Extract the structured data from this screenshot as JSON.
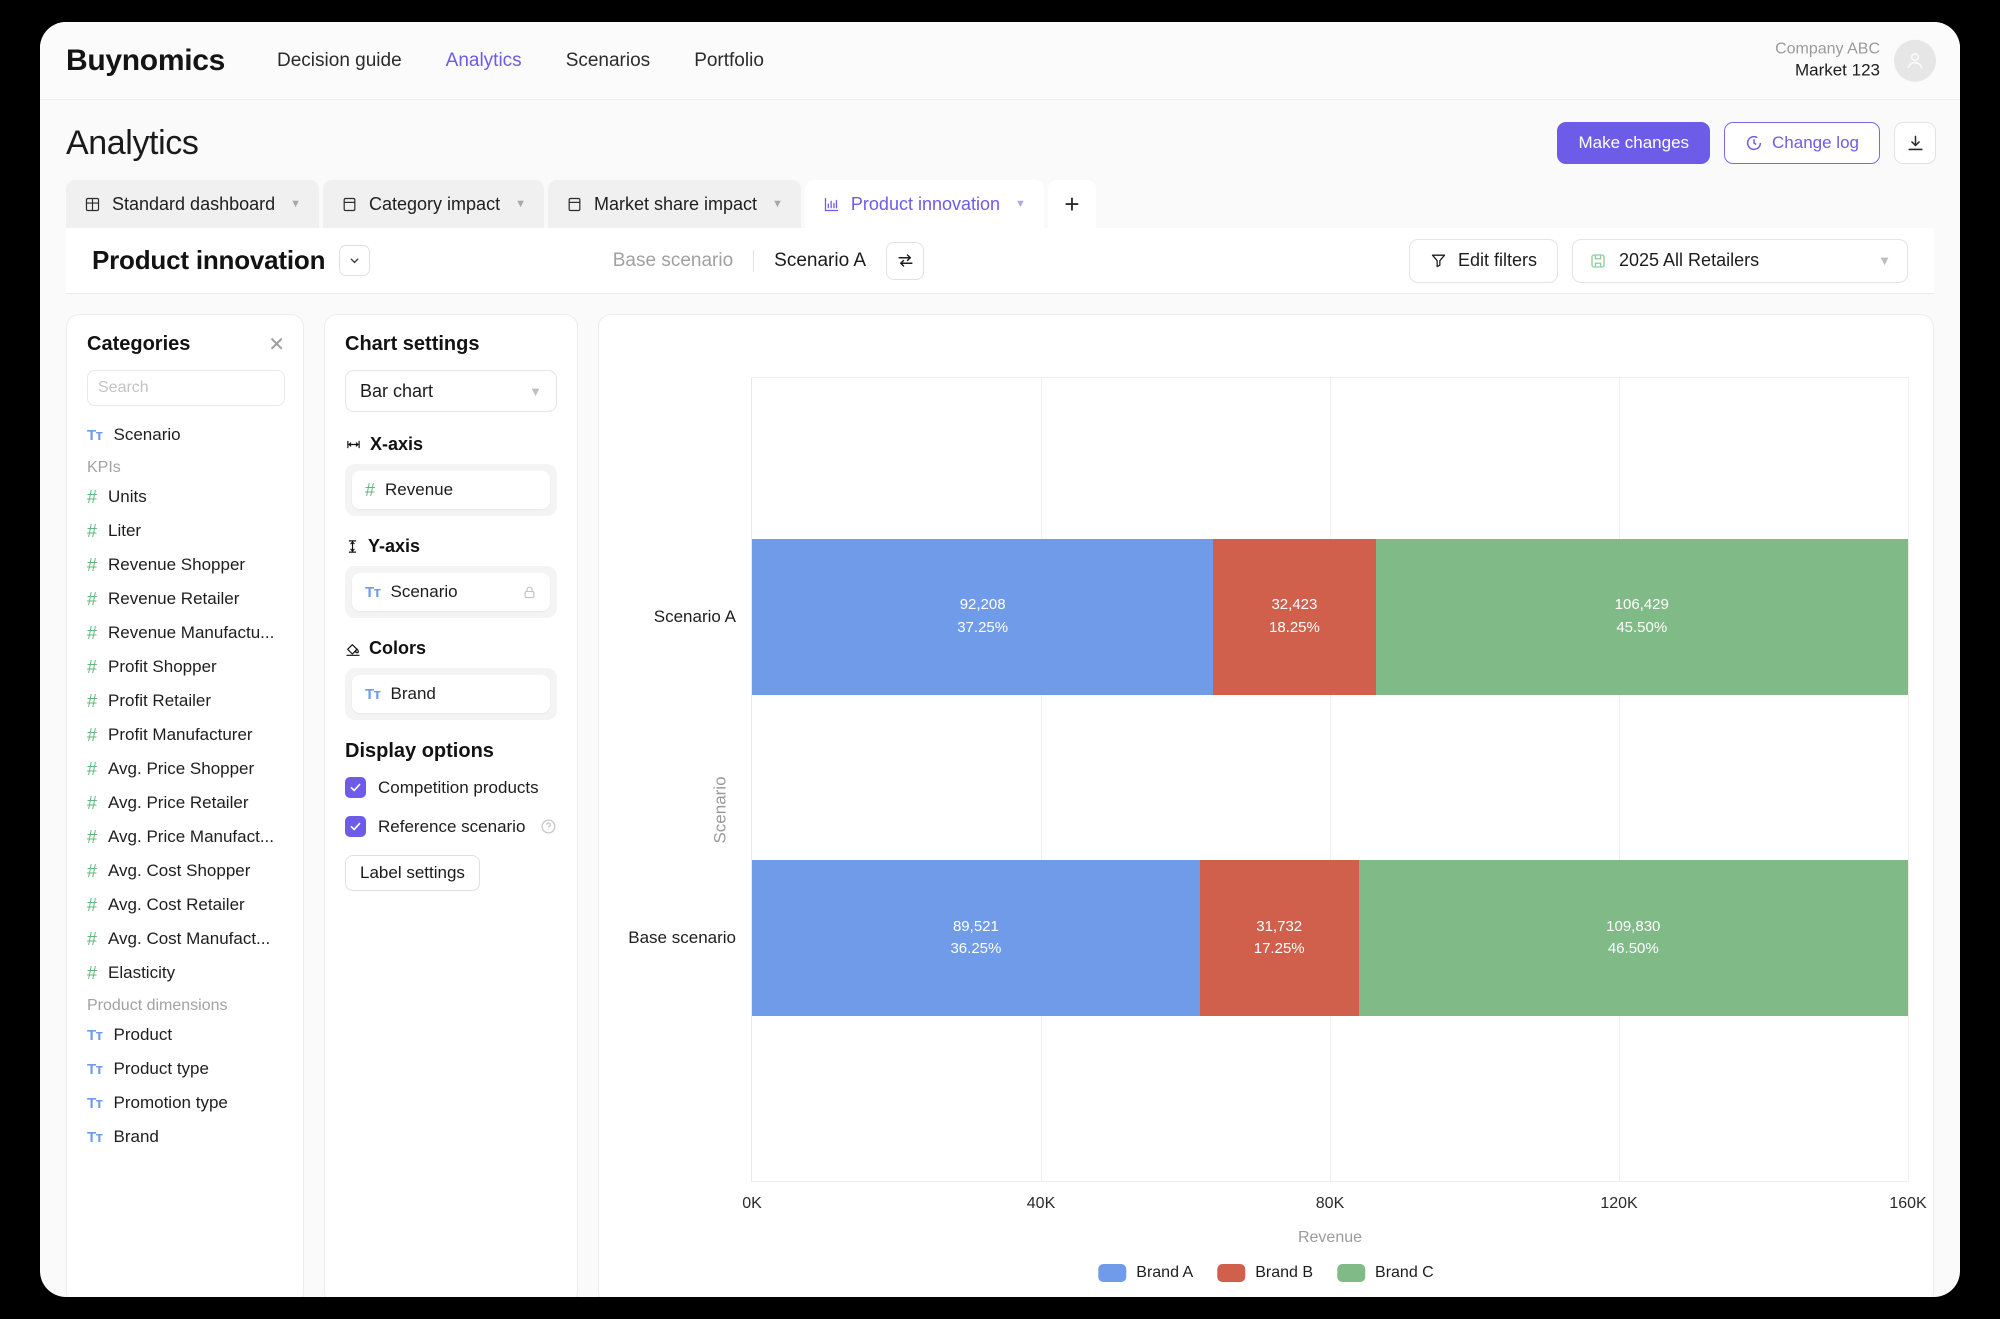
{
  "topnav": {
    "brand": "Buynomics",
    "links": [
      {
        "label": "Decision guide",
        "active": false
      },
      {
        "label": "Analytics",
        "active": true
      },
      {
        "label": "Scenarios",
        "active": false
      },
      {
        "label": "Portfolio",
        "active": false
      }
    ],
    "account": {
      "company": "Company ABC",
      "market": "Market 123"
    }
  },
  "header": {
    "title": "Analytics",
    "make_changes": "Make changes",
    "change_log": "Change log"
  },
  "tabs": [
    {
      "label": "Standard dashboard",
      "icon": "dashboard-icon",
      "active": false
    },
    {
      "label": "Category impact",
      "icon": "panel-icon",
      "active": false
    },
    {
      "label": "Market share impact",
      "icon": "panel-icon",
      "active": false
    },
    {
      "label": "Product innovation",
      "icon": "bar-chart-icon",
      "active": true
    }
  ],
  "tab_add_label": "+",
  "toolbar": {
    "title": "Product innovation",
    "base_scenario": "Base scenario",
    "scenario_a": "Scenario A",
    "edit_filters": "Edit filters",
    "retailer_selection": "2025 All Retailers"
  },
  "categories": {
    "title": "Categories",
    "search_placeholder": "Search",
    "search_value": "",
    "items": [
      {
        "label": "Scenario",
        "icon": "text-type-icon",
        "type": "text"
      },
      {
        "label": "KPIs",
        "type": "group"
      },
      {
        "label": "Units",
        "icon": "number-type-icon",
        "type": "number"
      },
      {
        "label": "Liter",
        "icon": "number-type-icon",
        "type": "number"
      },
      {
        "label": "Revenue Shopper",
        "icon": "number-type-icon",
        "type": "number"
      },
      {
        "label": "Revenue Retailer",
        "icon": "number-type-icon",
        "type": "number"
      },
      {
        "label": "Revenue Manufactu...",
        "icon": "number-type-icon",
        "type": "number"
      },
      {
        "label": "Profit Shopper",
        "icon": "number-type-icon",
        "type": "number"
      },
      {
        "label": "Profit Retailer",
        "icon": "number-type-icon",
        "type": "number"
      },
      {
        "label": "Profit Manufacturer",
        "icon": "number-type-icon",
        "type": "number"
      },
      {
        "label": "Avg. Price Shopper",
        "icon": "number-type-icon",
        "type": "number"
      },
      {
        "label": "Avg. Price Retailer",
        "icon": "number-type-icon",
        "type": "number"
      },
      {
        "label": "Avg. Price Manufact...",
        "icon": "number-type-icon",
        "type": "number"
      },
      {
        "label": "Avg. Cost Shopper",
        "icon": "number-type-icon",
        "type": "number"
      },
      {
        "label": "Avg. Cost Retailer",
        "icon": "number-type-icon",
        "type": "number"
      },
      {
        "label": "Avg. Cost Manufact...",
        "icon": "number-type-icon",
        "type": "number"
      },
      {
        "label": "Elasticity",
        "icon": "number-type-icon",
        "type": "number"
      },
      {
        "label": "Product dimensions",
        "type": "group"
      },
      {
        "label": "Product",
        "icon": "text-type-icon",
        "type": "text"
      },
      {
        "label": "Product type",
        "icon": "text-type-icon",
        "type": "text"
      },
      {
        "label": "Promotion type",
        "icon": "text-type-icon",
        "type": "text"
      },
      {
        "label": "Brand",
        "icon": "text-type-icon",
        "type": "text"
      }
    ]
  },
  "chart_settings": {
    "title": "Chart settings",
    "chart_type": "Bar chart",
    "x_axis_label": "X-axis",
    "x_axis_field": "Revenue",
    "y_axis_label": "Y-axis",
    "y_axis_field": "Scenario",
    "colors_label": "Colors",
    "colors_field": "Brand",
    "display_options_title": "Display options",
    "competition_products": "Competition products",
    "competition_products_checked": true,
    "reference_scenario": "Reference scenario",
    "reference_scenario_checked": true,
    "label_settings": "Label settings"
  },
  "chart_data": {
    "type": "bar",
    "orientation": "horizontal",
    "stacked": true,
    "title": "",
    "xlabel": "Revenue",
    "ylabel": "Scenario",
    "xlim": [
      0,
      160000
    ],
    "xticks": [
      0,
      40000,
      80000,
      120000,
      160000
    ],
    "xticklabels": [
      "0K",
      "40K",
      "80K",
      "120K",
      "160K"
    ],
    "categories": [
      "Scenario A",
      "Base scenario"
    ],
    "legend_position": "bottom",
    "grid": true,
    "series": [
      {
        "name": "Brand A",
        "color": "#6f9be8",
        "values": [
          92208,
          89521
        ],
        "value_labels": [
          "92,208",
          "89,521"
        ],
        "percent_labels": [
          "37.25%",
          "36.25%"
        ]
      },
      {
        "name": "Brand B",
        "color": "#d0604c",
        "values": [
          32423,
          31732
        ],
        "value_labels": [
          "32,423",
          "31,732"
        ],
        "percent_labels": [
          "18.25%",
          "17.25%"
        ]
      },
      {
        "name": "Brand C",
        "color": "#7fba87",
        "values": [
          106429,
          109830
        ],
        "value_labels": [
          "106,429",
          "109,830"
        ],
        "percent_labels": [
          "45.50%",
          "46.50%"
        ]
      }
    ]
  }
}
